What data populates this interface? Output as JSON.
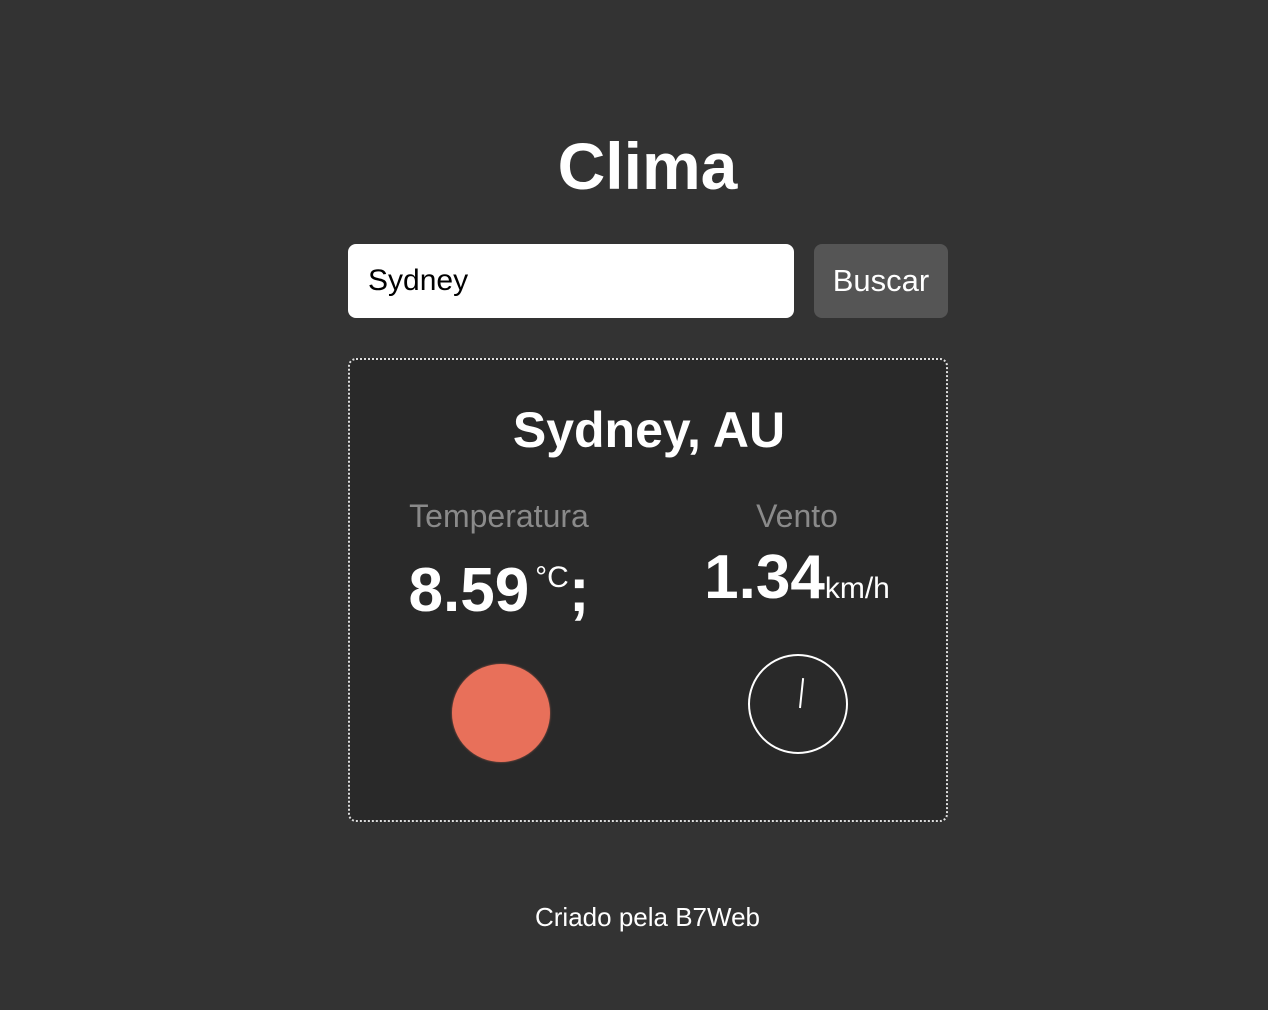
{
  "app": {
    "title": "Clima"
  },
  "search": {
    "value": "Sydney",
    "placeholder": "",
    "button_label": "Buscar"
  },
  "result": {
    "city": "Sydney, AU",
    "temperature": {
      "label": "Temperatura",
      "value": "8.59",
      "unit": "°C",
      "suffix": ";",
      "indicator_color": "#e8705a"
    },
    "wind": {
      "label": "Vento",
      "value": "1.34",
      "unit": "km/h"
    }
  },
  "footer": {
    "text": "Criado pela B7Web"
  },
  "colors": {
    "background": "#333333",
    "card": "#292929",
    "button": "#555555",
    "label": "#8a8a8a"
  },
  "icons": [
    "wind-dial-icon",
    "temperature-indicator-icon"
  ]
}
